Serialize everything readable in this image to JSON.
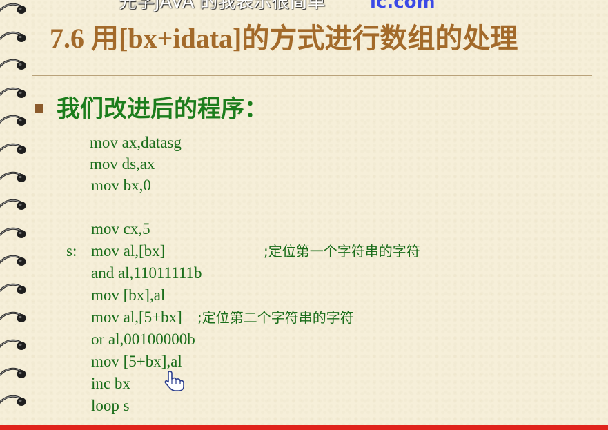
{
  "overlay": {
    "text": "先学JAVA 的我表示很简单",
    "url": "ic.com"
  },
  "slide": {
    "title": "7.6 用[bx+idata]的方式进行数组的处理",
    "heading": "我们改进后的程序："
  },
  "code": [
    {
      "label": "",
      "text": "mov ax,datasg",
      "comment": ""
    },
    {
      "label": "",
      "text": "mov ds,ax",
      "comment": ""
    },
    {
      "label": "",
      "text": "mov bx,0",
      "comment": ""
    },
    {
      "label": "",
      "text": "mov cx,5",
      "comment": ""
    },
    {
      "label": "s:",
      "text": "mov al,[bx]",
      "comment": ";定位第一个字符串的字符"
    },
    {
      "label": "",
      "text": "and al,11011111b",
      "comment": ""
    },
    {
      "label": "",
      "text": "mov [bx],al",
      "comment": ""
    },
    {
      "label": "",
      "text": "mov al,[5+bx]",
      "comment": ";定位第二个字符串的字符"
    },
    {
      "label": "",
      "text": "or al,00100000b",
      "comment": ""
    },
    {
      "label": "",
      "text": "mov [5+bx],al",
      "comment": ""
    },
    {
      "label": "",
      "text": "inc bx",
      "comment": ""
    },
    {
      "label": "",
      "text": "loop s",
      "comment": ""
    }
  ],
  "colors": {
    "title": "#a36a2a",
    "code": "#1b6e1b",
    "heading": "#1c7d1c",
    "bar": "#e0241c"
  },
  "icons": {
    "cursor": "hand-pointer-icon",
    "binding": "spiral-ring-icon"
  }
}
